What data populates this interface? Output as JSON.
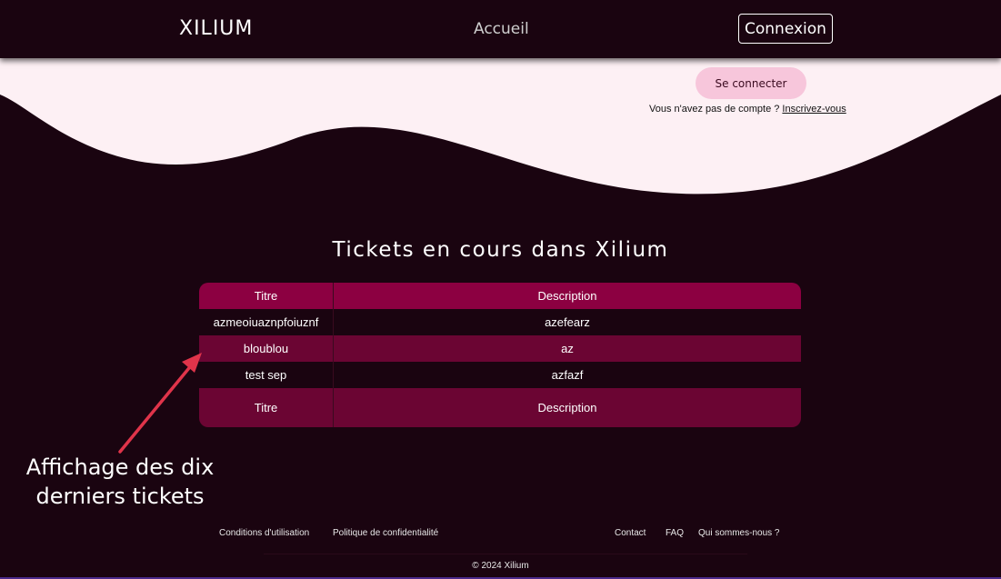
{
  "navbar": {
    "logo": "XILIUM",
    "home_link": "Accueil",
    "login_button": "Connexion"
  },
  "hero": {
    "connect_button": "Se connecter",
    "signup_prompt": "Vous n'avez pas de compte ? ",
    "signup_link": "Inscrivez-vous"
  },
  "tickets": {
    "title": "Tickets en cours dans Xilium",
    "header": {
      "title": "Titre",
      "description": "Description"
    },
    "rows": [
      {
        "title": "azmeoiuaznpfoiuznf",
        "description": "azefearz"
      },
      {
        "title": "bloublou",
        "description": "az"
      },
      {
        "title": "test sep",
        "description": "azfazf"
      }
    ],
    "footer": {
      "title": "Titre",
      "description": "Description"
    }
  },
  "annotation": {
    "line1": "Affichage des dix",
    "line2": "derniers tickets"
  },
  "footer": {
    "terms": "Conditions d'utilisation",
    "privacy": "Politique de confidentialité",
    "contact": "Contact",
    "faq": "FAQ",
    "about": "Qui sommes-nous ?",
    "copyright": "© 2024 Xilium"
  },
  "colors": {
    "background": "#1a0410",
    "header_row": "#8c0041",
    "alt_row": "#6b0533",
    "connect_button": "#f7c6db",
    "annotation_arrow": "#e0344a"
  }
}
